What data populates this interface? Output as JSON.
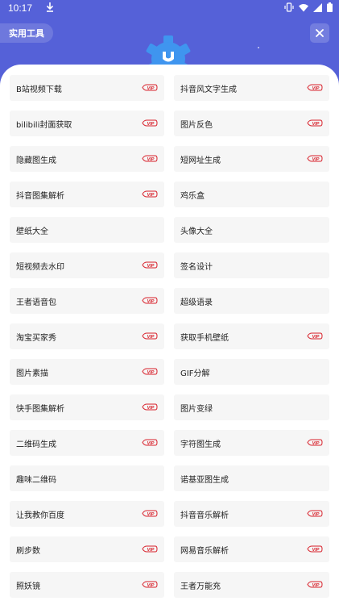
{
  "status": {
    "time": "10:17"
  },
  "header": {
    "title": "实用工具"
  },
  "vip_badge": {
    "text": "VIP",
    "color": "#d8202a"
  },
  "colors": {
    "header_bg": "#5561d8",
    "gear": "#3f95ef",
    "card_bg": "#f6f6f6"
  },
  "tools": [
    {
      "label": "B站视频下载",
      "vip": true
    },
    {
      "label": "抖音风文字生成",
      "vip": true
    },
    {
      "label": "bilibili封面获取",
      "vip": true
    },
    {
      "label": "图片反色",
      "vip": true
    },
    {
      "label": "隐藏图生成",
      "vip": true
    },
    {
      "label": "短网址生成",
      "vip": true
    },
    {
      "label": "抖音图集解析",
      "vip": true
    },
    {
      "label": "鸡乐盒",
      "vip": false
    },
    {
      "label": "壁纸大全",
      "vip": false
    },
    {
      "label": "头像大全",
      "vip": false
    },
    {
      "label": "短视频去水印",
      "vip": true
    },
    {
      "label": "签名设计",
      "vip": false
    },
    {
      "label": "王者语音包",
      "vip": true
    },
    {
      "label": "超级语录",
      "vip": false
    },
    {
      "label": "淘宝买家秀",
      "vip": true
    },
    {
      "label": "获取手机壁纸",
      "vip": true
    },
    {
      "label": "图片素描",
      "vip": true
    },
    {
      "label": "GIF分解",
      "vip": false
    },
    {
      "label": "快手图集解析",
      "vip": true
    },
    {
      "label": "图片变绿",
      "vip": false
    },
    {
      "label": "二维码生成",
      "vip": true
    },
    {
      "label": "字符图生成",
      "vip": true
    },
    {
      "label": "趣味二维码",
      "vip": false
    },
    {
      "label": "诺基亚图生成",
      "vip": false
    },
    {
      "label": "让我教你百度",
      "vip": true
    },
    {
      "label": "抖音音乐解析",
      "vip": true
    },
    {
      "label": "刷步数",
      "vip": true
    },
    {
      "label": "网易音乐解析",
      "vip": true
    },
    {
      "label": "照妖镜",
      "vip": true
    },
    {
      "label": "王者万能充",
      "vip": true
    }
  ]
}
